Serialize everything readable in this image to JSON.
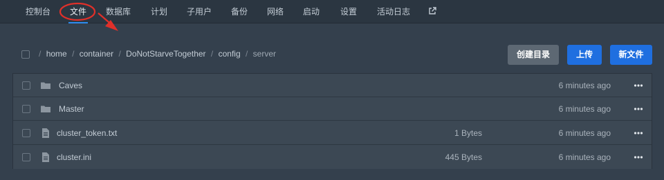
{
  "nav": {
    "items": [
      {
        "label": "控制台",
        "active": false
      },
      {
        "label": "文件",
        "active": true
      },
      {
        "label": "数据库",
        "active": false
      },
      {
        "label": "计划",
        "active": false
      },
      {
        "label": "子用户",
        "active": false
      },
      {
        "label": "备份",
        "active": false
      },
      {
        "label": "网络",
        "active": false
      },
      {
        "label": "启动",
        "active": false
      },
      {
        "label": "设置",
        "active": false
      },
      {
        "label": "活动日志",
        "active": false
      }
    ],
    "external_icon": "external-link-icon"
  },
  "breadcrumb": {
    "segments": [
      "home",
      "container",
      "DoNotStarveTogether",
      "config",
      "server"
    ]
  },
  "actions": {
    "create_dir": "创建目录",
    "upload": "上传",
    "new_file": "新文件"
  },
  "files": [
    {
      "name": "Caves",
      "type": "folder",
      "size": "",
      "modified": "6 minutes ago"
    },
    {
      "name": "Master",
      "type": "folder",
      "size": "",
      "modified": "6 minutes ago"
    },
    {
      "name": "cluster_token.txt",
      "type": "file",
      "size": "1 Bytes",
      "modified": "6 minutes ago"
    },
    {
      "name": "cluster.ini",
      "type": "file",
      "size": "445 Bytes",
      "modified": "6 minutes ago"
    }
  ],
  "colors": {
    "background": "#34404d",
    "nav_background": "#2b3641",
    "accent": "#1f6fe0",
    "annotation": "#e0302a"
  }
}
